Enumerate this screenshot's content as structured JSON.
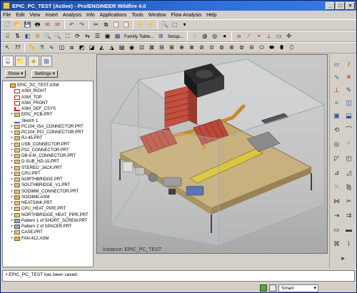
{
  "window": {
    "title": "EPIC_PC_TEST (Active) - Pro/ENGINEER Wildfire 4.0",
    "minimize": "_",
    "maximize": "□",
    "close": "×"
  },
  "menu": [
    "File",
    "Edit",
    "View",
    "Insert",
    "Analysis",
    "Info",
    "Applications",
    "Tools",
    "Window",
    "Flow Analysis",
    "Help"
  ],
  "toolbar": {
    "family_table": "Family Table...",
    "setup": "Setup..."
  },
  "left_pane": {
    "show_label": "Show ▾",
    "settings_label": "Settings ▾"
  },
  "tree": [
    {
      "label": "EPIC_PC_TEST.ASM",
      "icon": "asm",
      "exp": ""
    },
    {
      "label": "ASM_RIGHT",
      "icon": "datum",
      "exp": ""
    },
    {
      "label": "ASM_TOP",
      "icon": "datum",
      "exp": ""
    },
    {
      "label": "ASM_FRONT",
      "icon": "datum",
      "exp": ""
    },
    {
      "label": "ASM_DEF_CSYS",
      "icon": "csys",
      "exp": ""
    },
    {
      "label": "EPIC_PCB.PRT",
      "icon": "part",
      "exp": "+"
    },
    {
      "label": "Sketch 1",
      "icon": "sketch",
      "exp": ""
    },
    {
      "label": "PC104_ISA_CONNECTOR.PRT",
      "icon": "part",
      "exp": "+"
    },
    {
      "label": "PC104_PCI_CONNECTOR.PRT",
      "icon": "part",
      "exp": "+"
    },
    {
      "label": "RJ-45.PRT",
      "icon": "part",
      "exp": "+"
    },
    {
      "label": "USB_CONNECTOR.PRT",
      "icon": "part",
      "exp": "+"
    },
    {
      "label": "PS2_CONNECTOR.PRT",
      "icon": "part",
      "exp": "+"
    },
    {
      "label": "DB-9-M_CONNECTOR.PRT",
      "icon": "part",
      "exp": "+"
    },
    {
      "label": "D-SUB_HD-15.PRT",
      "icon": "part",
      "exp": "+"
    },
    {
      "label": "STEREO_JACK.PRT",
      "icon": "part",
      "exp": "+"
    },
    {
      "label": "CPU.PRT",
      "icon": "part",
      "exp": "+"
    },
    {
      "label": "NORTHBRIDGE.PRT",
      "icon": "part",
      "exp": "+"
    },
    {
      "label": "SOUTHBRIDGE_V1.PRT",
      "icon": "part",
      "exp": "+"
    },
    {
      "label": "SODIMM_CONNECTOR.PRT",
      "icon": "part",
      "exp": "+"
    },
    {
      "label": "SODIMM.ASM",
      "icon": "asm",
      "exp": "+"
    },
    {
      "label": "HEATSINK.PRT",
      "icon": "part",
      "exp": "+"
    },
    {
      "label": "CPU_HEAT_PIPE.PRT",
      "icon": "part",
      "exp": "+"
    },
    {
      "label": "NORTHBRIDGE_HEAT_PIPE.PRT",
      "icon": "part",
      "exp": "+"
    },
    {
      "label": "Pattern 1 of SHORT_SCREW.PRT",
      "icon": "pattern",
      "exp": "+"
    },
    {
      "label": "Pattern 2 of SPACER.PRT",
      "icon": "pattern",
      "exp": "+"
    },
    {
      "label": "CASE.PRT",
      "icon": "part",
      "exp": "+"
    },
    {
      "label": "FAN-412.ASM",
      "icon": "asm",
      "exp": "+"
    }
  ],
  "viewport": {
    "instance_label": "Instance: EPIC_PC_TEST"
  },
  "message": "• EPIC_PC_TEST has been saved.",
  "status": {
    "filter_value": "Smart"
  }
}
